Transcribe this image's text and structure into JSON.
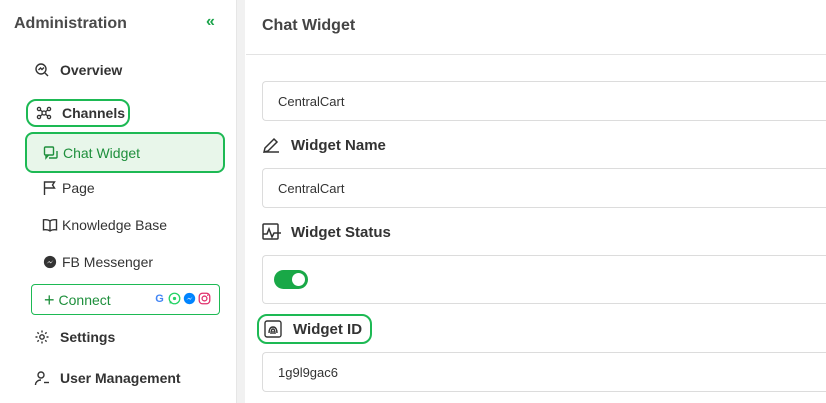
{
  "sidebar": {
    "title": "Administration",
    "items": {
      "overview": "Overview",
      "channels": "Channels",
      "chat_widget": "Chat Widget",
      "page": "Page",
      "knowledge_base": "Knowledge Base",
      "fb_messenger": "FB Messenger",
      "connect": "Connect",
      "settings": "Settings",
      "user_management": "User Management"
    },
    "connect_brands": [
      "google-icon",
      "whatsapp-icon",
      "messenger-icon",
      "instagram-icon"
    ]
  },
  "main": {
    "title": "Chat Widget",
    "top_field_value": "CentralCart",
    "widget_name": {
      "label": "Widget Name",
      "value": "CentralCart"
    },
    "widget_status": {
      "label": "Widget Status",
      "enabled": true
    },
    "widget_id": {
      "label": "Widget ID",
      "value": "1g9l9gac6"
    }
  },
  "colors": {
    "accent": "#1db954",
    "active_bg": "#e8f6ea",
    "toggle_on": "#19a847"
  }
}
